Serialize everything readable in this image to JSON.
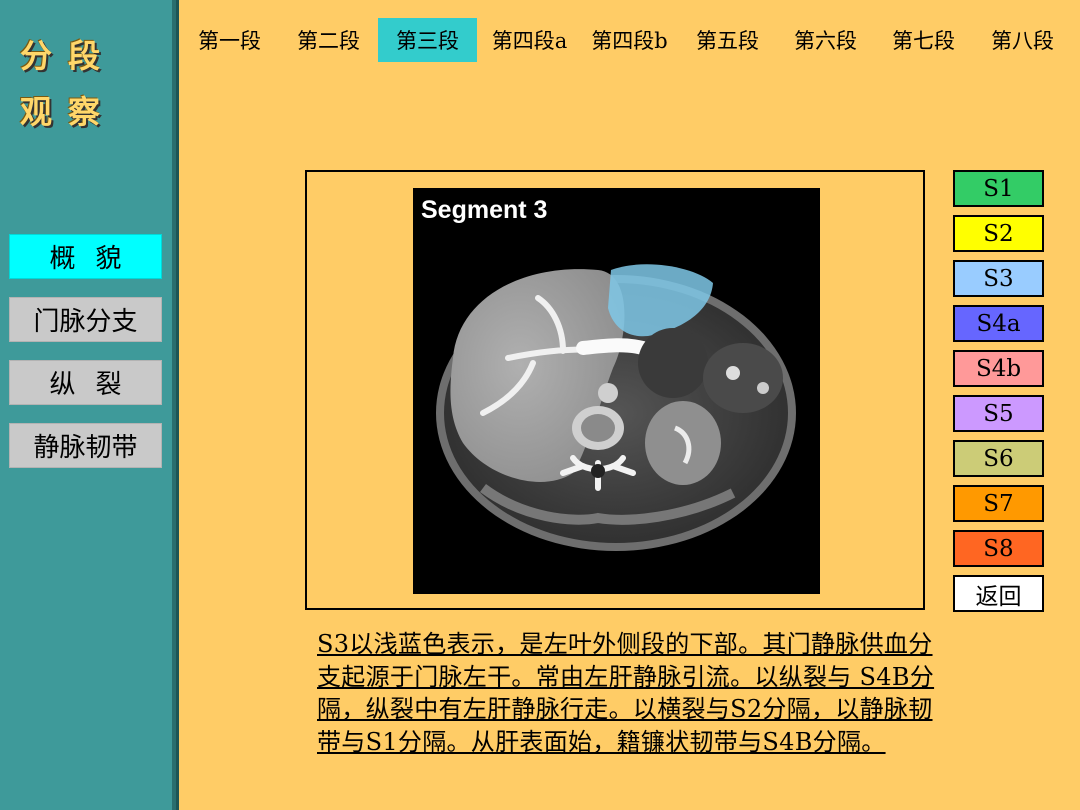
{
  "sidebar": {
    "title_line1": "分段",
    "title_line2": "观察",
    "buttons": [
      {
        "label": "概貌"
      },
      {
        "label": "门脉分支"
      },
      {
        "label": "纵裂"
      },
      {
        "label": "静脉韧带"
      }
    ]
  },
  "top_nav": {
    "tabs": [
      {
        "label": "第一段"
      },
      {
        "label": "第二段"
      },
      {
        "label": "第三段",
        "active": true
      },
      {
        "label": "第四段a"
      },
      {
        "label": "第四段b"
      },
      {
        "label": "第五段"
      },
      {
        "label": "第六段"
      },
      {
        "label": "第七段"
      },
      {
        "label": "第八段"
      }
    ]
  },
  "image": {
    "caption": "Segment 3",
    "highlight_color": "#7FC8E8"
  },
  "segments": [
    {
      "label": "S1",
      "color": "#33CC66"
    },
    {
      "label": "S2",
      "color": "#FFFF00"
    },
    {
      "label": "S3",
      "color": "#99CCFF"
    },
    {
      "label": "S4a",
      "color": "#6666FF"
    },
    {
      "label": "S4b",
      "color": "#FF9999"
    },
    {
      "label": "S5",
      "color": "#CC99FF"
    },
    {
      "label": "S6",
      "color": "#CCCC77"
    },
    {
      "label": "S7",
      "color": "#FF9900"
    },
    {
      "label": "S8",
      "color": "#FF6622"
    },
    {
      "label": "返回",
      "color": "#FFFFFF"
    }
  ],
  "description": "S3以浅蓝色表示，是左叶外侧段的下部。其门静脉供血分支起源于门脉左干。常由左肝静脉引流。以纵裂与 S4B分隔，纵裂中有左肝静脉行走。以横裂与S2分隔，以静脉韧带与S1分隔。从肝表面始，籍镰状韧带与S4B分隔。"
}
